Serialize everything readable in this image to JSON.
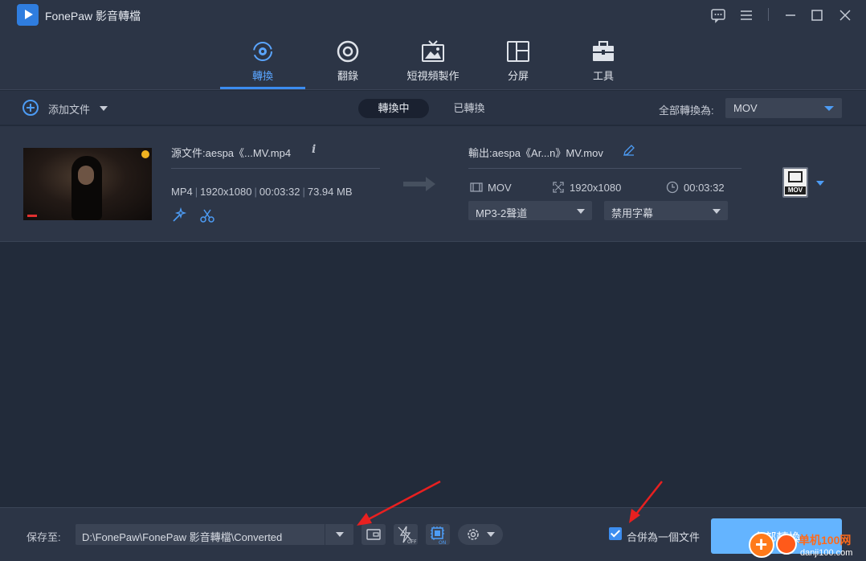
{
  "app": {
    "title": "FonePaw 影音轉檔"
  },
  "nav": {
    "tabs": [
      {
        "label": "轉換"
      },
      {
        "label": "翻錄"
      },
      {
        "label": "短視頻製作"
      },
      {
        "label": "分屏"
      },
      {
        "label": "工具"
      }
    ],
    "active_index": 0
  },
  "toolbar": {
    "add_label": "添加文件",
    "seg_converting": "轉換中",
    "seg_converted": "已轉換",
    "convert_all_label": "全部轉換為:",
    "convert_all_value": "MOV"
  },
  "file": {
    "source_label": "源文件:aespa《...MV.mp4",
    "info_glyph": "i",
    "meta": {
      "format": "MP4",
      "resolution": "1920x1080",
      "duration": "00:03:32",
      "size": "73.94 MB"
    },
    "output_label": "輸出:aespa《Ar...n》MV.mov",
    "output": {
      "format": "MOV",
      "resolution": "1920x1080",
      "duration": "00:03:32"
    },
    "audio_track": "MP3-2聲道",
    "subtitle": "禁用字幕",
    "format_badge": "MOV"
  },
  "footer": {
    "save_label": "保存至:",
    "save_path": "D:\\FonePaw\\FonePaw 影音轉檔\\Converted",
    "merge_checked": true,
    "merge_label": "合併為一個文件",
    "convert_all_button": "全部轉換"
  },
  "watermark": {
    "text": "单机100网",
    "sub": "danji100.com"
  },
  "colors": {
    "accent": "#3b8cf0",
    "background": "#222b3a",
    "panel": "#2c3546",
    "convert_button": "#64b4ff",
    "annotation_arrow": "#e82020"
  }
}
